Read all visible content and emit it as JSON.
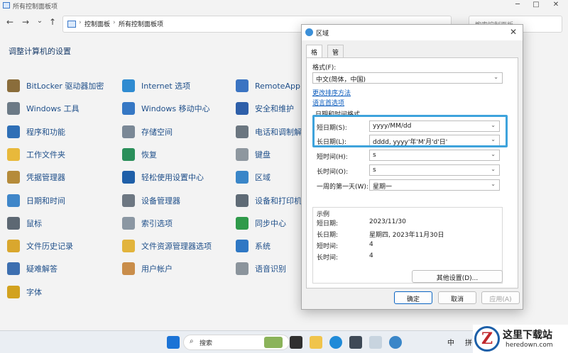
{
  "window": {
    "title": "所有控制面板项",
    "min": "─",
    "max": "□",
    "close": "✕"
  },
  "nav": {
    "back": "←",
    "forward": "→",
    "dropdown": "⌄",
    "up": "↑",
    "breadcrumb": [
      "控制面板",
      "所有控制面板项"
    ],
    "sep": "›",
    "search_placeholder": "搜索控制面板",
    "search_icon": "⌕"
  },
  "page_heading": "调整计算机的设置",
  "items": [
    {
      "label": "BitLocker 驱动器加密",
      "icon": "key-icon",
      "color": "#8a6d3b"
    },
    {
      "label": "Windows 工具",
      "icon": "gear-icon",
      "color": "#6c7a86"
    },
    {
      "label": "程序和功能",
      "icon": "programs-icon",
      "color": "#2f6fb6"
    },
    {
      "label": "工作文件夹",
      "icon": "folder-icon",
      "color": "#e8b93b"
    },
    {
      "label": "凭据管理器",
      "icon": "vault-icon",
      "color": "#b58b3a"
    },
    {
      "label": "日期和时间",
      "icon": "calendar-icon",
      "color": "#3f86c9"
    },
    {
      "label": "鼠标",
      "icon": "mouse-icon",
      "color": "#5d6873"
    },
    {
      "label": "文件历史记录",
      "icon": "file-history-icon",
      "color": "#d9a72e"
    },
    {
      "label": "疑难解答",
      "icon": "troubleshoot-icon",
      "color": "#3d6fb0"
    },
    {
      "label": "字体",
      "icon": "font-icon",
      "color": "#d2a21f"
    },
    {
      "label": "Internet 选项",
      "icon": "internet-icon",
      "color": "#2f8bd1"
    },
    {
      "label": "Windows 移动中心",
      "icon": "mobility-icon",
      "color": "#3577c4"
    },
    {
      "label": "存储空间",
      "icon": "storage-icon",
      "color": "#7a8896"
    },
    {
      "label": "恢复",
      "icon": "recovery-icon",
      "color": "#2a8f5a"
    },
    {
      "label": "轻松使用设置中心",
      "icon": "accessibility-icon",
      "color": "#1f5fa8"
    },
    {
      "label": "设备管理器",
      "icon": "device-manager-icon",
      "color": "#6d7782"
    },
    {
      "label": "索引选项",
      "icon": "index-icon",
      "color": "#8b97a3"
    },
    {
      "label": "文件资源管理器选项",
      "icon": "explorer-options-icon",
      "color": "#e2b43c"
    },
    {
      "label": "用户帐户",
      "icon": "users-icon",
      "color": "#c98d4a"
    },
    {
      "label": "RemoteApp",
      "icon": "remoteapp-icon",
      "color": "#3b74c2"
    },
    {
      "label": "安全和维护",
      "icon": "flag-icon",
      "color": "#2e5fa9"
    },
    {
      "label": "电话和调制解",
      "icon": "phone-icon",
      "color": "#6b7680"
    },
    {
      "label": "键盘",
      "icon": "keyboard-icon",
      "color": "#8e979f"
    },
    {
      "label": "区域",
      "icon": "globe-icon",
      "color": "#3a86c8"
    },
    {
      "label": "设备和打印机",
      "icon": "printer-icon",
      "color": "#5f6b76"
    },
    {
      "label": "同步中心",
      "icon": "sync-icon",
      "color": "#2f9a4a"
    },
    {
      "label": "系统",
      "icon": "monitor-icon",
      "color": "#2f78c4"
    },
    {
      "label": "语音识别",
      "icon": "microphone-icon",
      "color": "#8b949c"
    }
  ],
  "dialog": {
    "title": "区域",
    "close": "✕",
    "tabs": [
      "格式",
      "管理"
    ],
    "format_label": "格式(F):",
    "format_value": "中文(简体，中国)",
    "link_sort": "更改排序方法",
    "link_lang": "语言首选项",
    "datetime_group": "日期和时间格式",
    "fields": [
      {
        "label": "短日期(S):",
        "value": "yyyy/MM/dd"
      },
      {
        "label": "长日期(L):",
        "value": "dddd, yyyy'年'M'月'd'日'"
      },
      {
        "label": "短时间(H):",
        "value": "s"
      },
      {
        "label": "长时间(O):",
        "value": "s"
      },
      {
        "label": "一周的第一天(W):",
        "value": "星期一"
      }
    ],
    "example_group": "示例",
    "examples": [
      {
        "label": "短日期:",
        "value": "2023/11/30"
      },
      {
        "label": "长日期:",
        "value": "星期四, 2023年11月30日"
      },
      {
        "label": "短时间:",
        "value": "4"
      },
      {
        "label": "长时间:",
        "value": "4"
      }
    ],
    "other_settings": "其他设置(D)...",
    "ok": "确定",
    "cancel": "取消",
    "apply": "应用(A)",
    "dropdown_arrow": "⌄"
  },
  "taskbar": {
    "search_label": "搜索",
    "search_icon": "⌕",
    "ime_1": "中",
    "ime_2": "拼"
  },
  "watermark": {
    "logo": "Z",
    "title": "这里下载站",
    "url": "heredown.com"
  }
}
